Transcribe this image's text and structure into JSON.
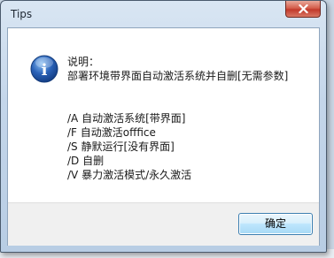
{
  "window": {
    "title": "Tips"
  },
  "icon": {
    "name": "information-icon",
    "glyph": "i",
    "color": "#2a62b8"
  },
  "message": {
    "heading": "说明：",
    "description": "部署环境带界面自动激活系统并自删[无需参数]",
    "options": [
      "/A 自动激活系统[带界面]",
      "/F 自动激活offfice",
      "/S 静默运行[没有界面]",
      "/D 自删",
      "/V 暴力激活模式/永久激活"
    ]
  },
  "buttons": {
    "ok_label": "确定"
  }
}
